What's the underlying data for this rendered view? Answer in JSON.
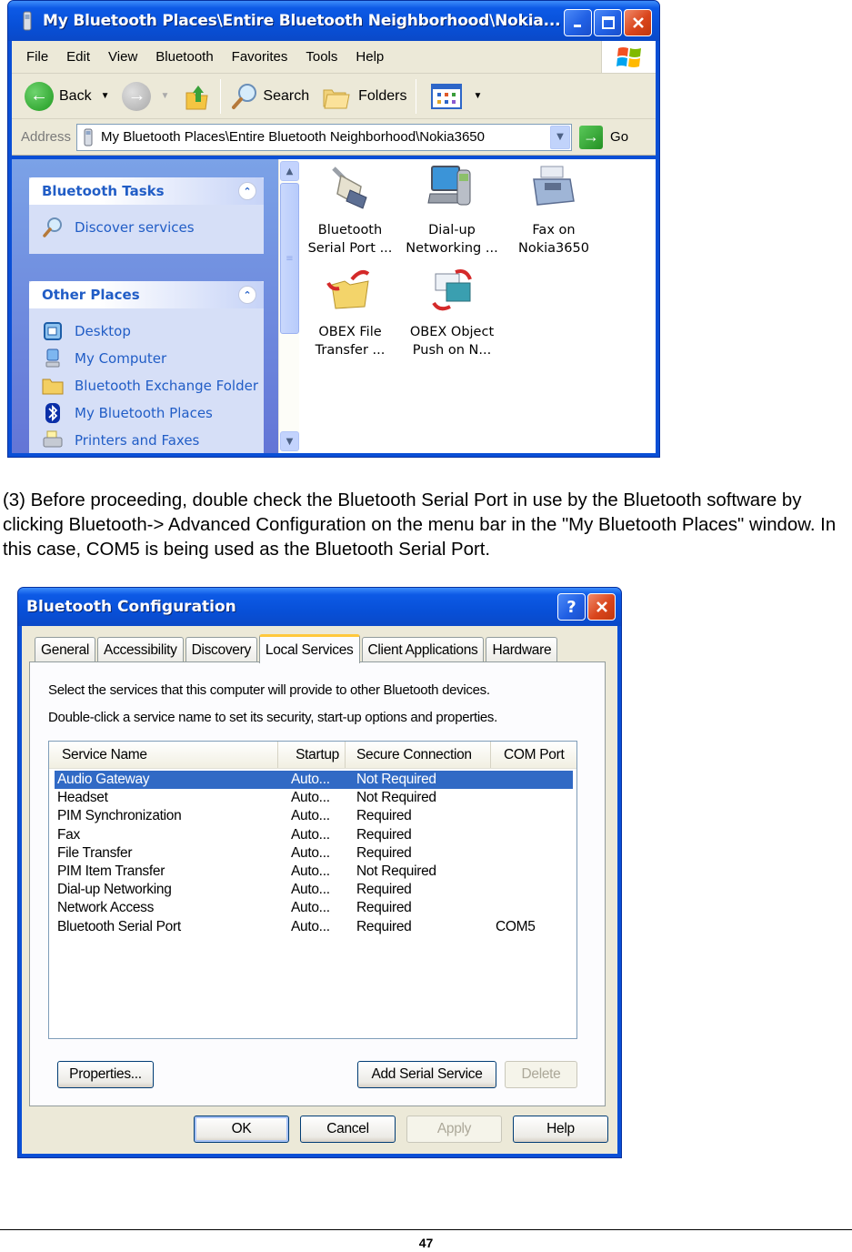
{
  "explorer": {
    "title": "My Bluetooth Places\\Entire Bluetooth Neighborhood\\Nokia...",
    "menu": [
      "File",
      "Edit",
      "View",
      "Bluetooth",
      "Favorites",
      "Tools",
      "Help"
    ],
    "toolbar": {
      "back": "Back",
      "search": "Search",
      "folders": "Folders"
    },
    "address": {
      "label": "Address",
      "value": "My Bluetooth Places\\Entire Bluetooth Neighborhood\\Nokia3650",
      "go": "Go"
    },
    "task_panes": [
      {
        "title": "Bluetooth Tasks",
        "items": [
          {
            "label": "Discover services",
            "icon": "search-icon"
          }
        ]
      },
      {
        "title": "Other Places",
        "items": [
          {
            "label": "Desktop",
            "icon": "desktop-icon"
          },
          {
            "label": "My Computer",
            "icon": "computer-icon"
          },
          {
            "label": "Bluetooth Exchange Folder",
            "icon": "folder-icon"
          },
          {
            "label": "My Bluetooth Places",
            "icon": "bluetooth-icon"
          },
          {
            "label": "Printers and Faxes",
            "icon": "printer-icon"
          }
        ]
      }
    ],
    "files": [
      {
        "label": "Bluetooth\nSerial Port ...",
        "icon": "serial-port-icon"
      },
      {
        "label": "Dial-up\nNetworking ...",
        "icon": "dialup-icon"
      },
      {
        "label": "Fax on\nNokia3650",
        "icon": "fax-icon"
      },
      {
        "label": "OBEX File\nTransfer ...",
        "icon": "obex-file-icon"
      },
      {
        "label": "OBEX Object\nPush on N...",
        "icon": "obex-push-icon"
      }
    ]
  },
  "paragraph": "(3) Before proceeding, double check the Bluetooth Serial Port in use by the Bluetooth software by clicking Bluetooth-> Advanced Configuration on the menu bar in the \"My Bluetooth Places\" window. In this case, COM5 is being used as the Bluetooth Serial Port.",
  "dialog": {
    "title": "Bluetooth Configuration",
    "tabs": [
      "General",
      "Accessibility",
      "Discovery",
      "Local Services",
      "Client Applications",
      "Hardware"
    ],
    "active_tab": "Local Services",
    "instructions": [
      "Select the services that this computer will provide to other Bluetooth devices.",
      "Double-click a service name to set its security, start-up options and properties."
    ],
    "columns": [
      "Service Name",
      "Startup",
      "Secure Connection",
      "COM Port"
    ],
    "rows": [
      {
        "name": "Audio Gateway",
        "startup": "Auto...",
        "secure": "Not Required",
        "com": "",
        "selected": true
      },
      {
        "name": "Headset",
        "startup": "Auto...",
        "secure": "Not Required",
        "com": ""
      },
      {
        "name": "PIM Synchronization",
        "startup": "Auto...",
        "secure": "Required",
        "com": ""
      },
      {
        "name": "Fax",
        "startup": "Auto...",
        "secure": "Required",
        "com": ""
      },
      {
        "name": "File Transfer",
        "startup": "Auto...",
        "secure": "Required",
        "com": ""
      },
      {
        "name": "PIM Item Transfer",
        "startup": "Auto...",
        "secure": "Not Required",
        "com": ""
      },
      {
        "name": "Dial-up Networking",
        "startup": "Auto...",
        "secure": "Required",
        "com": ""
      },
      {
        "name": "Network Access",
        "startup": "Auto...",
        "secure": "Required",
        "com": ""
      },
      {
        "name": "Bluetooth Serial Port",
        "startup": "Auto...",
        "secure": "Required",
        "com": "COM5"
      }
    ],
    "buttons": {
      "properties": "Properties...",
      "add_serial": "Add Serial Service",
      "delete": "Delete",
      "ok": "OK",
      "cancel": "Cancel",
      "apply": "Apply",
      "help": "Help"
    }
  },
  "footer": {
    "page_number": "47"
  }
}
